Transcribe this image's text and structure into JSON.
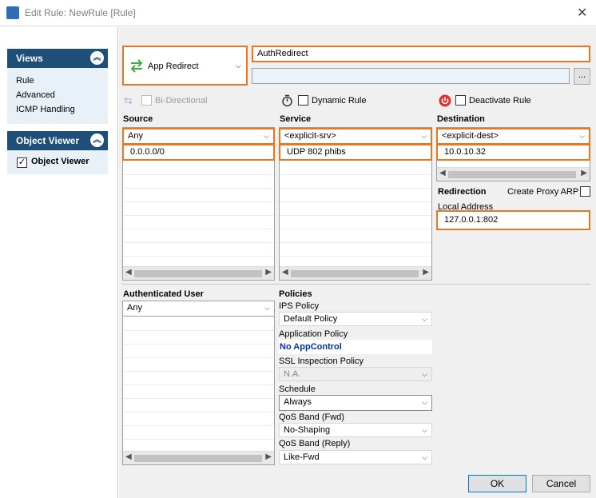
{
  "window": {
    "title": "Edit Rule: NewRule [Rule]"
  },
  "left": {
    "views": {
      "header": "Views",
      "items": [
        "Rule",
        "Advanced",
        "ICMP Handling"
      ]
    },
    "object_viewer": {
      "header": "Object Viewer",
      "checkbox_label": "Object Viewer",
      "checked": true
    }
  },
  "rule": {
    "action": "App Redirect",
    "name": "AuthRedirect",
    "description": "",
    "more_button": "...",
    "bidirectional": "Bi-Directional",
    "dynamic_rule": "Dynamic Rule",
    "deactivate_rule": "Deactivate Rule"
  },
  "source": {
    "label": "Source",
    "selected": "Any",
    "values": [
      "0.0.0.0/0"
    ]
  },
  "service": {
    "label": "Service",
    "selected": "<explicit-srv>",
    "values": [
      "UDP  802 phibs"
    ]
  },
  "destination": {
    "label": "Destination",
    "selected": "<explicit-dest>",
    "values": [
      "10.0.10.32"
    ]
  },
  "redirection": {
    "label": "Redirection",
    "create_proxy_arp": "Create Proxy ARP",
    "local_address_label": "Local Address",
    "local_address": "127.0.0.1:802"
  },
  "authenticated_user": {
    "label": "Authenticated User",
    "selected": "Any"
  },
  "policies": {
    "label": "Policies",
    "ips_label": "IPS Policy",
    "ips_value": "Default Policy",
    "app_label": "Application Policy",
    "app_value": "No AppControl",
    "ssl_label": "SSL Inspection Policy",
    "ssl_value": "N.A.",
    "schedule_label": "Schedule",
    "schedule_value": "Always",
    "qos_fwd_label": "QoS Band (Fwd)",
    "qos_fwd_value": "No-Shaping",
    "qos_reply_label": "QoS Band (Reply)",
    "qos_reply_value": "Like-Fwd"
  },
  "buttons": {
    "ok": "OK",
    "cancel": "Cancel"
  },
  "colors": {
    "accent": "#e87722",
    "header": "#1f4e79",
    "link": "#0033a0"
  }
}
